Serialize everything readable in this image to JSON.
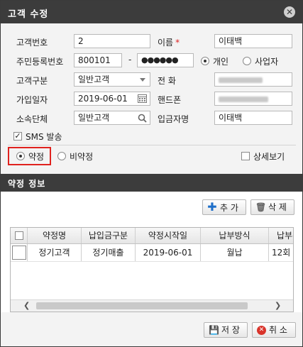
{
  "dialog": {
    "title": "고객 수정",
    "close_glyph": "✕"
  },
  "form": {
    "customer_no_label": "고객번호",
    "customer_no_value": "2",
    "name_label": "이름",
    "name_required": "*",
    "name_value": "이태백",
    "rrn_label": "주민등록번호",
    "rrn_front": "800101",
    "rrn_dash": "-",
    "rrn_back_masked": "●●●●●●",
    "type_individual": "개인",
    "type_business": "사업자",
    "customer_type_label": "고객구분",
    "customer_type_value": "일반고객",
    "phone_label": "전 화",
    "join_date_label": "가입일자",
    "join_date_value": "2019-06-01",
    "mobile_label": "핸드폰",
    "org_label": "소속단체",
    "org_value": "일반고객",
    "depositor_label": "입금자명",
    "depositor_value": "이태백",
    "sms_label": "SMS 발송",
    "contract_label": "약정",
    "non_contract_label": "비약정",
    "detail_view_label": "상세보기"
  },
  "section": {
    "title": "약정 정보",
    "add_label": "추 가",
    "delete_label": "삭 제"
  },
  "table": {
    "columns": [
      "약정명",
      "납입금구분",
      "약정시작일",
      "납부방식",
      "납부횟"
    ],
    "rows": [
      [
        "정기고객",
        "정기매출",
        "2019-06-01",
        "월납",
        "12회"
      ]
    ]
  },
  "footer": {
    "save_label": "저 장",
    "cancel_label": "취 소"
  }
}
